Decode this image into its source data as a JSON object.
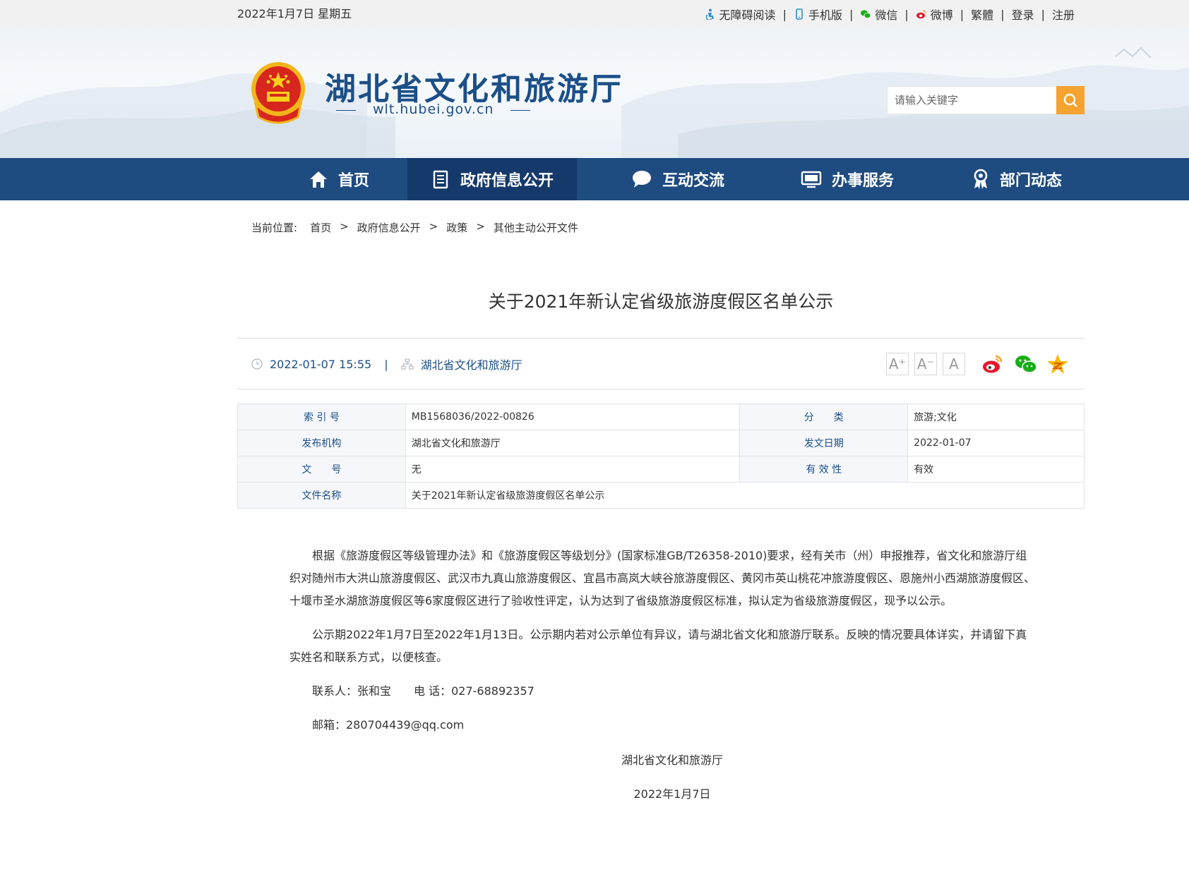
{
  "topbar": {
    "date": "2022年1月7日 星期五",
    "links": {
      "accessible": "无障碍阅读",
      "mobile": "手机版",
      "wechat": "微信",
      "weibo": "微博",
      "traditional": "繁體",
      "login": "登录",
      "register": "注册"
    },
    "sep": "|"
  },
  "header": {
    "title": "湖北省文化和旅游厅",
    "url": "wlt.hubei.gov.cn",
    "search_placeholder": "请输入关键字"
  },
  "nav": {
    "items": [
      {
        "label": "首页"
      },
      {
        "label": "政府信息公开"
      },
      {
        "label": "互动交流"
      },
      {
        "label": "办事服务"
      },
      {
        "label": "部门动态"
      }
    ],
    "active_index": 1
  },
  "breadcrumb": {
    "label": "当前位置:",
    "items": [
      "首页",
      "政府信息公开",
      "政策",
      "其他主动公开文件"
    ],
    "sep": ">"
  },
  "article": {
    "title": "关于2021年新认定省级旅游度假区名单公示",
    "datetime": "2022-01-07 15:55",
    "publisher": "湖北省文化和旅游厅",
    "meta_sep": "|",
    "font_buttons": [
      "A⁺",
      "A⁻",
      "A"
    ]
  },
  "info_table": {
    "index_label": "索 引 号",
    "index_value": "MB1568036/2022-00826",
    "category_label": "分　　类",
    "category_value": "旅游;文化",
    "org_label": "发布机构",
    "org_value": "湖北省文化和旅游厅",
    "date_label": "发文日期",
    "date_value": "2022-01-07",
    "docno_label": "文　　号",
    "docno_value": "无",
    "validity_label": "有 效 性",
    "validity_value": "有效",
    "name_label": "文件名称",
    "name_value": "关于2021年新认定省级旅游度假区名单公示"
  },
  "body": {
    "p1": "根据《旅游度假区等级管理办法》和《旅游度假区等级划分》(国家标准GB/T26358-2010)要求，经有关市（州）申报推荐，省文化和旅游厅组织对随州市大洪山旅游度假区、武汉市九真山旅游度假区、宜昌市高岚大峡谷旅游度假区、黄冈市英山桃花冲旅游度假区、恩施州小西湖旅游度假区、十堰市圣水湖旅游度假区等6家度假区进行了验收性评定，认为达到了省级旅游度假区标准，拟认定为省级旅游度假区，现予以公示。",
    "p2": "公示期2022年1月7日至2022年1月13日。公示期内若对公示单位有异议，请与湖北省文化和旅游厅联系。反映的情况要具体详实，并请留下真实姓名和联系方式，以便核查。",
    "contact": "联系人：张和宝　　电 话：027-68892357",
    "email": "邮箱：280704439@qq.com",
    "sign_org": "湖北省文化和旅游厅",
    "sign_date": "2022年1月7日"
  },
  "colors": {
    "nav_bg": "#1e4b80",
    "nav_active": "#15396a",
    "brand_blue": "#1c4f87",
    "search_btn": "#f5a330"
  }
}
